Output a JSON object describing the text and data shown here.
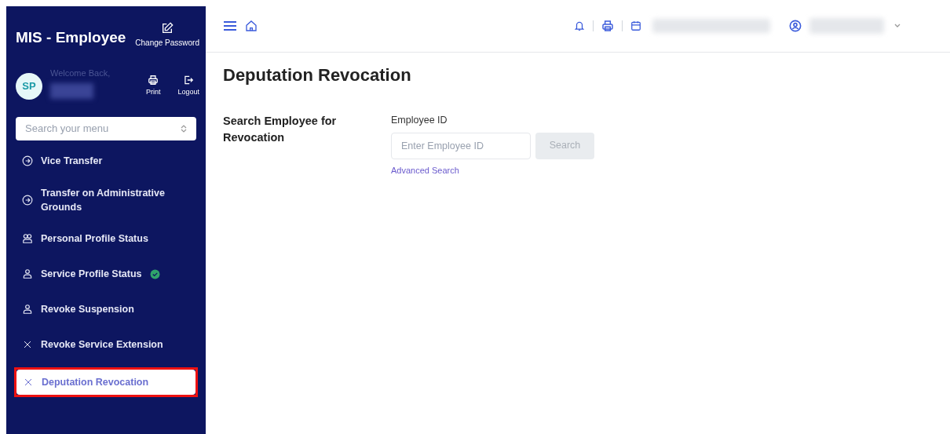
{
  "sidebar": {
    "app_title": "MIS - Employee",
    "change_password": "Change Password",
    "avatar": "SP",
    "welcome": "Welcome Back,",
    "actions": [
      {
        "kind": "print",
        "label": "Print"
      },
      {
        "kind": "logout",
        "label": "Logout"
      }
    ],
    "search": {
      "placeholder": "Search your menu"
    },
    "items": [
      {
        "label": "Vice Transfer",
        "kind": "arrow",
        "verified": false,
        "selected": false,
        "highlighted": false
      },
      {
        "label": "Transfer on Administrative Grounds",
        "kind": "arrow",
        "verified": false,
        "selected": false,
        "highlighted": false
      },
      {
        "label": "Personal Profile Status",
        "kind": "users",
        "verified": false,
        "selected": false,
        "highlighted": false
      },
      {
        "label": "Service Profile Status",
        "kind": "user",
        "verified": true,
        "selected": false,
        "highlighted": false
      },
      {
        "label": "Revoke Suspension",
        "kind": "user",
        "verified": false,
        "selected": false,
        "highlighted": false
      },
      {
        "label": "Revoke Service Extension",
        "kind": "x",
        "verified": false,
        "selected": false,
        "highlighted": false
      },
      {
        "label": "Deputation Revocation",
        "kind": "x",
        "verified": false,
        "selected": true,
        "highlighted": true
      }
    ]
  },
  "page": {
    "title": "Deputation Revocation",
    "section": "Search Employee for Revocation",
    "field_label": "Employee ID",
    "field": {
      "placeholder": "Enter Employee ID"
    },
    "search_button": {
      "label": "Search",
      "disabled": true
    },
    "advanced_link": "Advanced Search"
  }
}
